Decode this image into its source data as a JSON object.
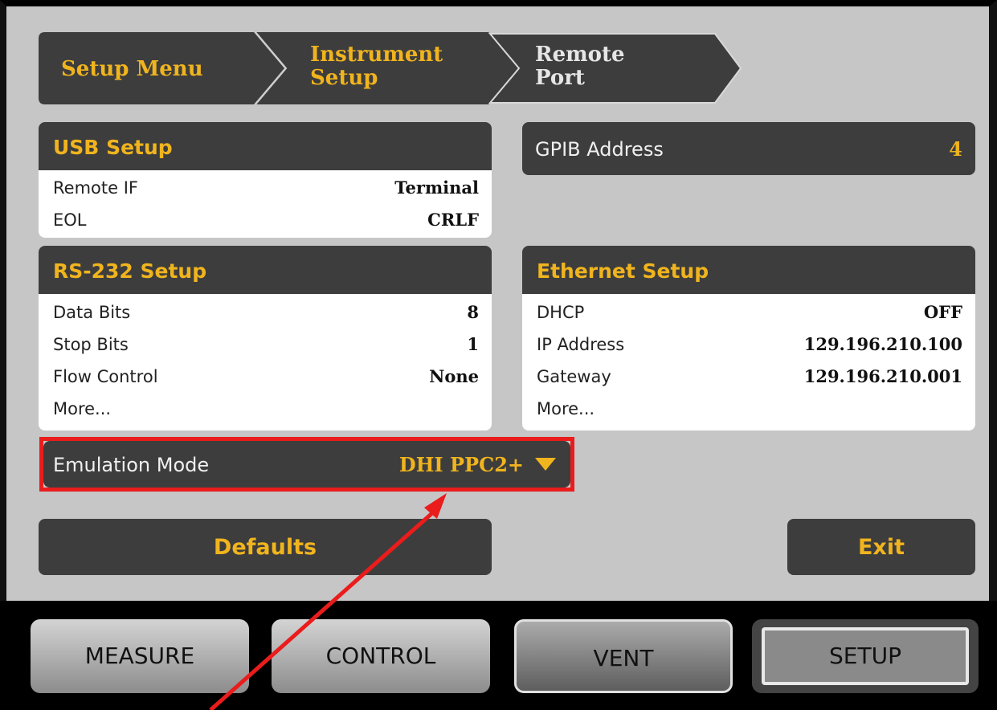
{
  "breadcrumb": {
    "items": [
      {
        "line1": "Setup Menu",
        "line2": ""
      },
      {
        "line1": "Instrument",
        "line2": "Setup"
      },
      {
        "line1": "Remote",
        "line2": "Port"
      }
    ]
  },
  "usb": {
    "title": "USB Setup",
    "rows": [
      {
        "label": "Remote IF",
        "value": "Terminal"
      },
      {
        "label": "EOL",
        "value": "CRLF"
      }
    ]
  },
  "gpib": {
    "label": "GPIB Address",
    "value": "4"
  },
  "rs232": {
    "title": "RS-232 Setup",
    "rows": [
      {
        "label": "Data Bits",
        "value": "8"
      },
      {
        "label": "Stop Bits",
        "value": "1"
      },
      {
        "label": "Flow Control",
        "value": "None"
      },
      {
        "label": "More...",
        "value": ""
      }
    ]
  },
  "ethernet": {
    "title": "Ethernet Setup",
    "rows": [
      {
        "label": "DHCP",
        "value": "OFF"
      },
      {
        "label": "IP Address",
        "value": "129.196.210.100"
      },
      {
        "label": "Gateway",
        "value": "129.196.210.001"
      },
      {
        "label": "More...",
        "value": ""
      }
    ]
  },
  "emulation": {
    "label": "Emulation Mode",
    "value": "DHI PPC2+",
    "icon": "triangle-down-icon"
  },
  "buttons": {
    "defaults": "Defaults",
    "exit": "Exit"
  },
  "nav": {
    "measure": "MEASURE",
    "control": "CONTROL",
    "vent": "VENT",
    "setup": "SETUP"
  },
  "colors": {
    "accent": "#f0b41e",
    "panel": "#c6c6c6",
    "dark": "#3d3d3d",
    "callout": "#ea1c1c"
  }
}
